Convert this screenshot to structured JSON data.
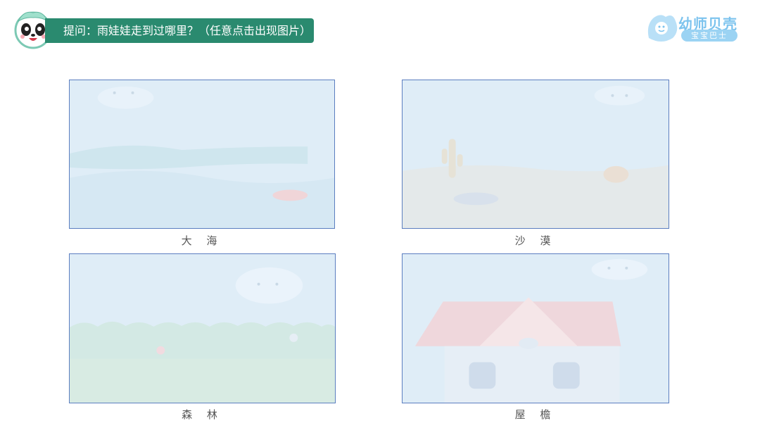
{
  "header": {
    "title": "提问：雨娃娃走到过哪里？（任意点击出现图片）"
  },
  "brand": {
    "name": "幼师贝壳",
    "subtitle": "宝宝巴士"
  },
  "cards": [
    {
      "label": "大 海"
    },
    {
      "label": "沙 漠"
    },
    {
      "label": "森 林"
    },
    {
      "label": "屋 檐"
    }
  ],
  "colors": {
    "banner": "#2a8a6f",
    "card_border": "#5b7ec0",
    "card_fill": "#dfedf7",
    "brand_blue": "#7cc3ee"
  }
}
